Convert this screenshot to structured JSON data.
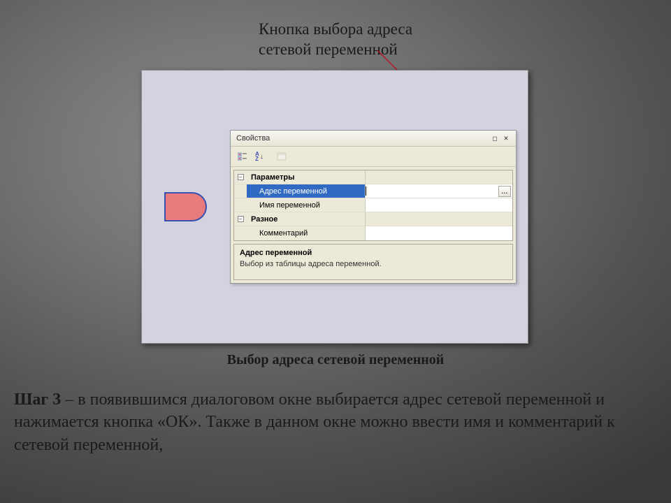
{
  "annotation": {
    "line1": "Кнопка выбора адреса",
    "line2": "сетевой переменной"
  },
  "panel": {
    "title": "Свойства",
    "toolbar": {
      "categorized_icon": "categorized-icon",
      "az_icon": "sort-az-icon",
      "page_icon": "property-page-icon"
    },
    "grid": {
      "cat1": "Параметры",
      "addr_label": "Адрес переменной",
      "addr_value": "",
      "name_label": "Имя переменной",
      "name_value": "",
      "cat2": "Разное",
      "comment_label": "Комментарий",
      "comment_value": "",
      "ellipsis": "..."
    },
    "desc": {
      "title": "Адрес переменной",
      "body": "Выбор из таблицы адреса переменной."
    }
  },
  "caption": "Выбор адреса сетевой переменной",
  "step": {
    "lead": "Шаг 3",
    "rest": " – в появившимся диалоговом окне выбирается адрес сетевой переменной и нажимается кнопка «ОК». Также в данном окне можно ввести имя и комментарий к сетевой переменной,"
  }
}
